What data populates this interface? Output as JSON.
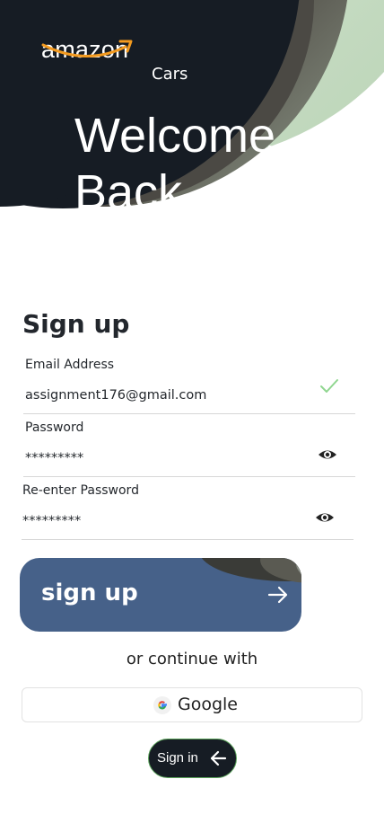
{
  "header": {
    "logo_text": "amazon",
    "logo_sub": "Cars",
    "welcome_line1": "Welcome",
    "welcome_line2": "Back"
  },
  "form": {
    "title": "Sign up",
    "email": {
      "label": "Email Address",
      "value": "assignment176@gmail.com",
      "status_icon": "check-icon"
    },
    "password": {
      "label": "Password",
      "value": "*********",
      "toggle_icon": "eye-icon"
    },
    "repassword": {
      "label": "Re-enter Password",
      "value": "*********",
      "toggle_icon": "eye-icon"
    }
  },
  "actions": {
    "signup_label": "sign up",
    "or_text": "or continue with",
    "google_label": "Google",
    "signin_label": "Sign in"
  },
  "colors": {
    "hero_dark": "#161c24",
    "hero_gray": "#4b4944",
    "hero_green": "#cfe0cc",
    "button_blue": "#466189",
    "check_green": "#8fd68f",
    "logo_orange": "#f39a1f"
  }
}
